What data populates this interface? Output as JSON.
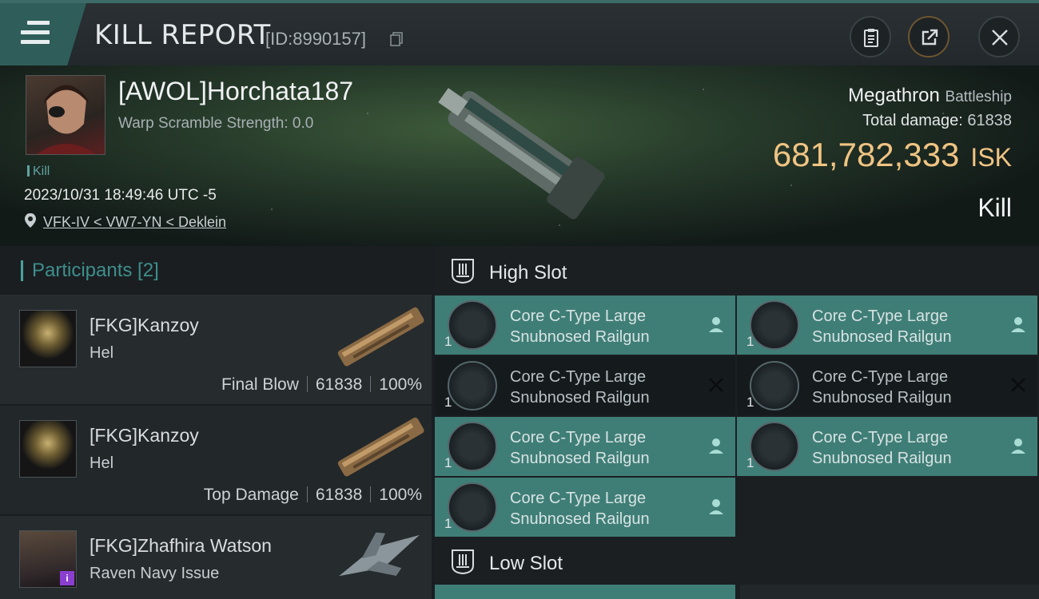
{
  "header": {
    "title": "KILL REPORT",
    "report_id": "[ID:8990157]"
  },
  "victim": {
    "name": "[AWOL]Horchata187",
    "warp_scramble": "Warp Scramble Strength: 0.0",
    "kill_tag": "Kill",
    "datetime": "2023/10/31 18:49:46 UTC -5",
    "location": "VFK-IV < VW7-YN < Deklein",
    "ship_name": "Megathron",
    "ship_class": "Battleship",
    "total_damage_label": "Total damage:",
    "total_damage": "61838",
    "isk_value": "681,782,333",
    "isk_unit": "ISK",
    "kill_type": "Kill"
  },
  "participants": {
    "title": "Participants [2]",
    "rows": [
      {
        "name": "[FKG]Kanzoy",
        "ship": "Hel",
        "role": "Final Blow",
        "damage": "61838",
        "percent": "100%"
      },
      {
        "name": "[FKG]Kanzoy",
        "ship": "Hel",
        "role": "Top Damage",
        "damage": "61838",
        "percent": "100%"
      },
      {
        "name": "[FKG]Zhafhira Watson",
        "ship": "Raven Navy Issue",
        "role": "",
        "damage": "",
        "percent": ""
      }
    ]
  },
  "slots": {
    "high_title": "High Slot",
    "low_title": "Low Slot",
    "high_items": [
      {
        "qty": "1",
        "line1": "Core C-Type Large",
        "line2": "Snubnosed Railgun",
        "status": "dropped"
      },
      {
        "qty": "1",
        "line1": "Core C-Type Large",
        "line2": "Snubnosed Railgun",
        "status": "dropped"
      },
      {
        "qty": "1",
        "line1": "Core C-Type Large",
        "line2": "Snubnosed Railgun",
        "status": "destroyed"
      },
      {
        "qty": "1",
        "line1": "Core C-Type Large",
        "line2": "Snubnosed Railgun",
        "status": "destroyed"
      },
      {
        "qty": "1",
        "line1": "Core C-Type Large",
        "line2": "Snubnosed Railgun",
        "status": "dropped"
      },
      {
        "qty": "1",
        "line1": "Core C-Type Large",
        "line2": "Snubnosed Railgun",
        "status": "dropped"
      },
      {
        "qty": "1",
        "line1": "Core C-Type Large",
        "line2": "Snubnosed Railgun",
        "status": "dropped"
      }
    ]
  },
  "colors": {
    "accent_teal": "#3f7e77",
    "isk_gold": "#f0c483"
  }
}
